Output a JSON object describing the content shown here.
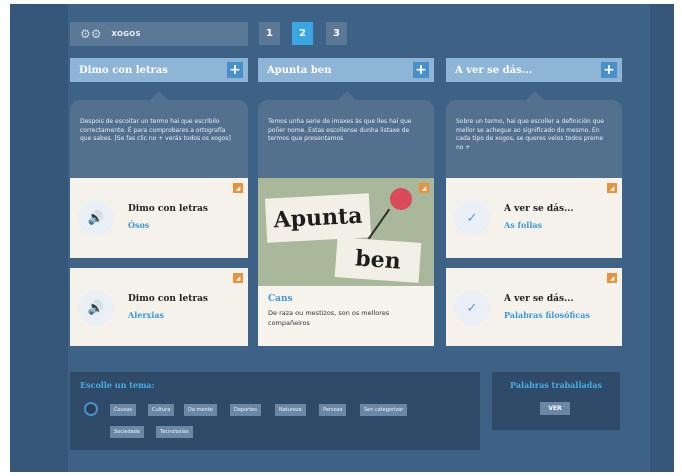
{
  "nav": {
    "games_label": "XOGOS",
    "pages": [
      "1",
      "2",
      "3"
    ],
    "active_page": "2"
  },
  "columns": [
    {
      "title": "Dimo con letras",
      "plus": "+",
      "description": "Despois de escoitar un termo hai que escribilo correctamente. É para comprobares a ortografía que sabes. [Se fas clic no + verás todos os xogos]",
      "cards": [
        {
          "title": "Dimo con letras",
          "subtitle": "Ósos"
        },
        {
          "title": "Dimo con letras",
          "subtitle": "Alerxias"
        }
      ]
    },
    {
      "title": "Apunta ben",
      "plus": "+",
      "description": "Temos unha serie de imaxes às que lles hai que poñer nome. Estas escollense dunha listaxe de termos que presentamos",
      "feature": {
        "image_line1": "Apunta",
        "image_line2": "ben",
        "title": "Cans",
        "text": "De raza ou mestizos, son os mellores compañeiros"
      }
    },
    {
      "title": "A ver se dás...",
      "plus": "+",
      "description": "Sobre un termo, hai que escoller a definición que mellor se achegue ao significado do mesmo. En cada tipo de xogos, se queres velos todos preme no +",
      "cards": [
        {
          "title": "A ver se dás...",
          "subtitle": "As follas"
        },
        {
          "title": "A ver se dás...",
          "subtitle": "Palabras filosóficas"
        }
      ]
    }
  ],
  "topics": {
    "heading": "Escolle un tema:",
    "tags": [
      "Cousas",
      "Cultura",
      "Da mente",
      "Deportes",
      "Natureza",
      "Persoas",
      "Sen categorizar",
      "Sociedade",
      "Tecnoloxías"
    ]
  },
  "words": {
    "heading": "Palabras traballadas",
    "button": "VER"
  },
  "colors": {
    "background": "#36577a",
    "accent": "#3aa6e2",
    "header": "#8eb4d6",
    "rss": "#e9923e"
  }
}
